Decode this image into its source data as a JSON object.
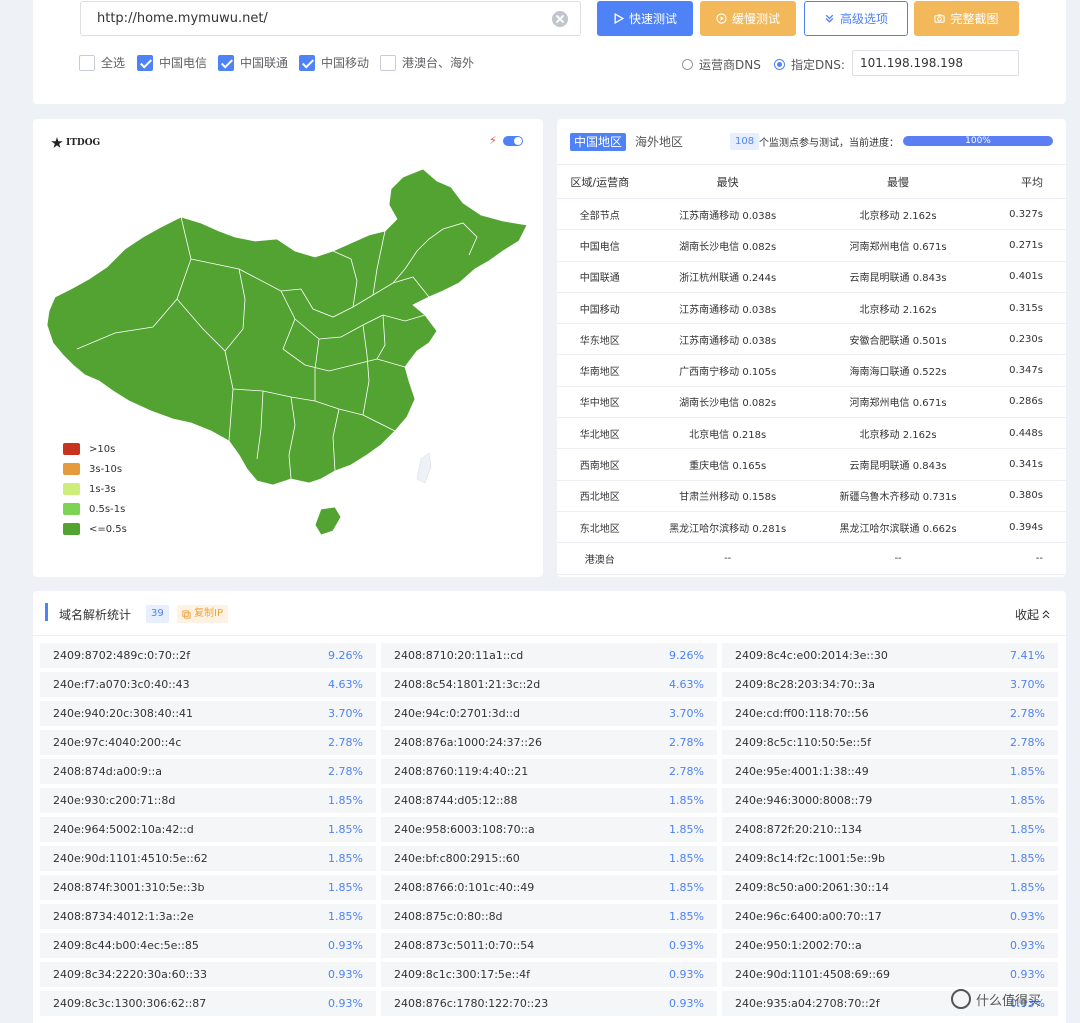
{
  "toolbar": {
    "url_value": "http://home.mymuwu.net/",
    "fast_test": "快速测试",
    "slow_test": "缓慢测试",
    "advanced": "高级选项",
    "screenshot": "完整截图"
  },
  "filters": {
    "select_all": "全选",
    "telecom": "中国电信",
    "unicom": "中国联通",
    "mobile": "中国移动",
    "overseas": "港澳台、海外"
  },
  "dns": {
    "isp_dns": "运营商DNS",
    "custom_dns": "指定DNS:",
    "value": "101.198.198.198"
  },
  "map": {
    "logo_text": "ITDOG",
    "bolt_icon": "⚡",
    "legend": [
      {
        "label": ">10s",
        "color": "#c8331f"
      },
      {
        "label": "3s-10s",
        "color": "#e59a3d"
      },
      {
        "label": "1s-3s",
        "color": "#cdee7a"
      },
      {
        "label": "0.5s-1s",
        "color": "#7dd353"
      },
      {
        "label": "<=0.5s",
        "color": "#53a332"
      }
    ]
  },
  "stats": {
    "tab_cn": "中国地区",
    "tab_overseas": "海外地区",
    "count": "108",
    "count_text": "个监测点参与测试，当前进度：",
    "progress": "100%",
    "headers": [
      "区域/运营商",
      "最快",
      "最慢",
      "平均"
    ],
    "rows": [
      [
        "全部节点",
        "江苏南通移动 0.038s",
        "北京移动 2.162s",
        "0.327s"
      ],
      [
        "中国电信",
        "湖南长沙电信 0.082s",
        "河南郑州电信 0.671s",
        "0.271s"
      ],
      [
        "中国联通",
        "浙江杭州联通 0.244s",
        "云南昆明联通 0.843s",
        "0.401s"
      ],
      [
        "中国移动",
        "江苏南通移动 0.038s",
        "北京移动 2.162s",
        "0.315s"
      ],
      [
        "华东地区",
        "江苏南通移动 0.038s",
        "安徽合肥联通 0.501s",
        "0.230s"
      ],
      [
        "华南地区",
        "广西南宁移动 0.105s",
        "海南海口联通 0.522s",
        "0.347s"
      ],
      [
        "华中地区",
        "湖南长沙电信 0.082s",
        "河南郑州电信 0.671s",
        "0.286s"
      ],
      [
        "华北地区",
        "北京电信 0.218s",
        "北京移动 2.162s",
        "0.448s"
      ],
      [
        "西南地区",
        "重庆电信 0.165s",
        "云南昆明联通 0.843s",
        "0.341s"
      ],
      [
        "西北地区",
        "甘肃兰州移动 0.158s",
        "新疆乌鲁木齐移动 0.731s",
        "0.380s"
      ],
      [
        "东北地区",
        "黑龙江哈尔滨移动 0.281s",
        "黑龙江哈尔滨联通 0.662s",
        "0.394s"
      ],
      [
        "港澳台",
        "--",
        "--",
        "--"
      ]
    ]
  },
  "resolution": {
    "title": "域名解析统计",
    "count": "39",
    "copy_ip": "复制IP",
    "collapse": "收起",
    "items": [
      {
        "ip": "2409:8702:489c:0:70::2f",
        "pct": "9.26%"
      },
      {
        "ip": "2408:8710:20:11a1::cd",
        "pct": "9.26%"
      },
      {
        "ip": "2409:8c4c:e00:2014:3e::30",
        "pct": "7.41%"
      },
      {
        "ip": "240e:f7:a070:3c0:40::43",
        "pct": "4.63%"
      },
      {
        "ip": "2408:8c54:1801:21:3c::2d",
        "pct": "4.63%"
      },
      {
        "ip": "2409:8c28:203:34:70::3a",
        "pct": "3.70%"
      },
      {
        "ip": "240e:940:20c:308:40::41",
        "pct": "3.70%"
      },
      {
        "ip": "240e:94c:0:2701:3d::d",
        "pct": "3.70%"
      },
      {
        "ip": "240e:cd:ff00:118:70::56",
        "pct": "2.78%"
      },
      {
        "ip": "240e:97c:4040:200::4c",
        "pct": "2.78%"
      },
      {
        "ip": "2408:876a:1000:24:37::26",
        "pct": "2.78%"
      },
      {
        "ip": "2409:8c5c:110:50:5e::5f",
        "pct": "2.78%"
      },
      {
        "ip": "2408:874d:a00:9::a",
        "pct": "2.78%"
      },
      {
        "ip": "2408:8760:119:4:40::21",
        "pct": "2.78%"
      },
      {
        "ip": "240e:95e:4001:1:38::49",
        "pct": "1.85%"
      },
      {
        "ip": "240e:930:c200:71::8d",
        "pct": "1.85%"
      },
      {
        "ip": "2408:8744:d05:12::88",
        "pct": "1.85%"
      },
      {
        "ip": "240e:946:3000:8008::79",
        "pct": "1.85%"
      },
      {
        "ip": "240e:964:5002:10a:42::d",
        "pct": "1.85%"
      },
      {
        "ip": "240e:958:6003:108:70::a",
        "pct": "1.85%"
      },
      {
        "ip": "2408:872f:20:210::134",
        "pct": "1.85%"
      },
      {
        "ip": "240e:90d:1101:4510:5e::62",
        "pct": "1.85%"
      },
      {
        "ip": "240e:bf:c800:2915::60",
        "pct": "1.85%"
      },
      {
        "ip": "2409:8c14:f2c:1001:5e::9b",
        "pct": "1.85%"
      },
      {
        "ip": "2408:874f:3001:310:5e::3b",
        "pct": "1.85%"
      },
      {
        "ip": "2408:8766:0:101c:40::49",
        "pct": "1.85%"
      },
      {
        "ip": "2409:8c50:a00:2061:30::14",
        "pct": "1.85%"
      },
      {
        "ip": "2408:8734:4012:1:3a::2e",
        "pct": "1.85%"
      },
      {
        "ip": "2408:875c:0:80::8d",
        "pct": "1.85%"
      },
      {
        "ip": "240e:96c:6400:a00:70::17",
        "pct": "0.93%"
      },
      {
        "ip": "2409:8c44:b00:4ec:5e::85",
        "pct": "0.93%"
      },
      {
        "ip": "2408:873c:5011:0:70::54",
        "pct": "0.93%"
      },
      {
        "ip": "240e:950:1:2002:70::a",
        "pct": "0.93%"
      },
      {
        "ip": "2409:8c34:2220:30a:60::33",
        "pct": "0.93%"
      },
      {
        "ip": "2409:8c1c:300:17:5e::4f",
        "pct": "0.93%"
      },
      {
        "ip": "240e:90d:1101:4508:69::69",
        "pct": "0.93%"
      },
      {
        "ip": "2409:8c3c:1300:306:62::87",
        "pct": "0.93%"
      },
      {
        "ip": "2408:876c:1780:122:70::23",
        "pct": "0.93%"
      },
      {
        "ip": "240e:935:a04:2708:70::2f",
        "pct": "0.93%"
      }
    ]
  },
  "watermark": "什么值得买"
}
